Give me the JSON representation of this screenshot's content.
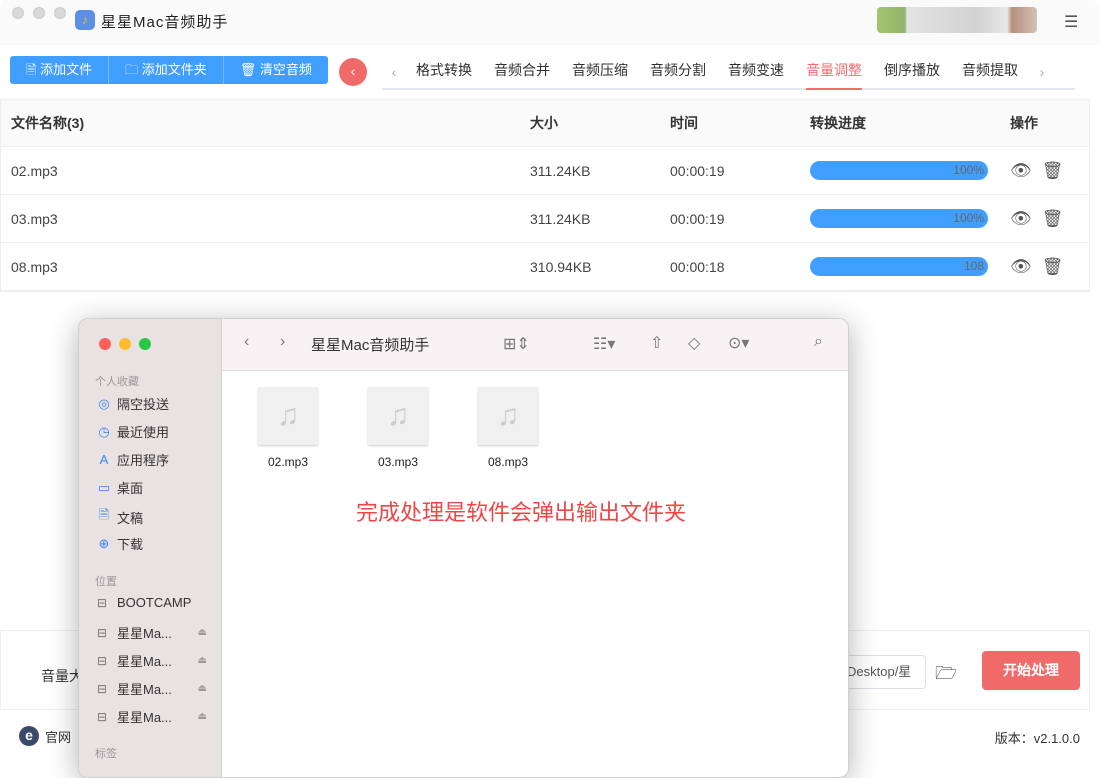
{
  "app": {
    "title": "星星Mac音频助手",
    "settings_icon": "sliders-icon"
  },
  "toolbar": {
    "add_file": "添加文件",
    "add_folder": "添加文件夹",
    "clear": "清空音频"
  },
  "tabs": [
    "格式转换",
    "音频合并",
    "音频压缩",
    "音频分割",
    "音频变速",
    "音量调整",
    "倒序播放",
    "音频提取"
  ],
  "active_tab": "音量调整",
  "table": {
    "headers": [
      "文件名称(3)",
      "大小",
      "时间",
      "转换进度",
      "操作"
    ],
    "rows": [
      {
        "name": "02.mp3",
        "size": "311.24KB",
        "time": "00:00:19",
        "progress": 100,
        "progress_label": "100%"
      },
      {
        "name": "03.mp3",
        "size": "311.24KB",
        "time": "00:00:19",
        "progress": 100,
        "progress_label": "100%"
      },
      {
        "name": "08.mp3",
        "size": "310.94KB",
        "time": "00:00:18",
        "progress": 100,
        "progress_label": "108"
      }
    ]
  },
  "bottom": {
    "volume_label": "音量大",
    "output_path": "Desktop/星",
    "start": "开始处理"
  },
  "footer": {
    "site": "官网",
    "version": "版本：v2.1.0.0"
  },
  "finder": {
    "title": "星星Mac音频助手",
    "favorites_label": "个人收藏",
    "favorites": [
      "隔空投送",
      "最近使用",
      "应用程序",
      "桌面",
      "文稿",
      "下载"
    ],
    "locations_label": "位置",
    "locations": [
      "BOOTCAMP",
      "星星Ma...",
      "星星Ma...",
      "星星Ma...",
      "星星Ma..."
    ],
    "tags_label": "标签",
    "files": [
      "02.mp3",
      "03.mp3",
      "08.mp3"
    ],
    "annotation": "完成处理是软件会弹出输出文件夹"
  },
  "colors": {
    "primary": "#409eff",
    "accent": "#f06a6a",
    "annotation": "#f04545"
  }
}
